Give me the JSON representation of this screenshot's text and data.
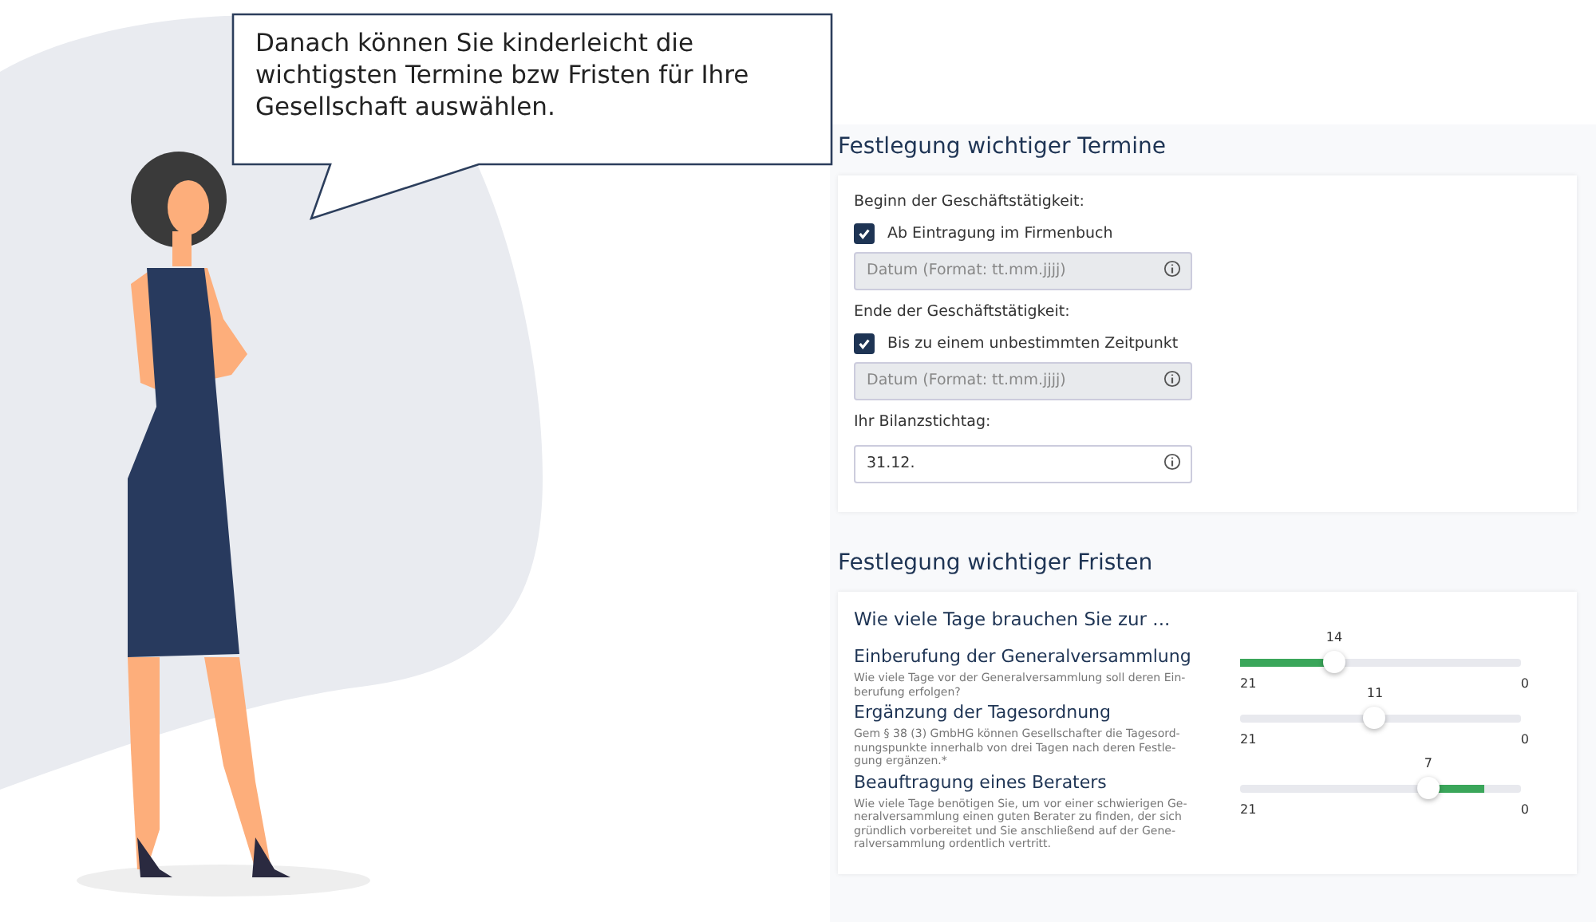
{
  "bubble": {
    "text": "Danach können Sie kinderleicht die wichtigsten Termine bzw Fristen für Ihre Gesellschaft auswählen."
  },
  "termine": {
    "title": "Festlegung wichtiger Termine",
    "groups": [
      {
        "label": "Beginn der Geschäftstätigkeit:",
        "checkbox": {
          "label": "Ab Eintragung im Firmenbuch",
          "checked": true
        },
        "field": {
          "placeholder": "Datum (Format: tt.mm.jjjj)",
          "disabled": true
        }
      },
      {
        "label": "Ende der Geschäftstätigkeit:",
        "checkbox": {
          "label": "Bis zu einem unbestimmten Zeitpunkt",
          "checked": true
        },
        "field": {
          "placeholder": "Datum (Format: tt.mm.jjjj)",
          "disabled": true
        }
      },
      {
        "label": "Ihr Bilanzstichtag:",
        "field": {
          "value": "31.12.",
          "disabled": false
        }
      }
    ]
  },
  "fristen": {
    "title": "Festlegung wichtiger Fristen",
    "question": "Wie viele Tage brauchen Sie zur ...",
    "items": [
      {
        "title": "Einberufung der Generalversammlung",
        "description": [
          "Wie viele Tage vor der Generalversammlung soll deren Ein-",
          "berufung erfolgen?"
        ],
        "value": "14",
        "level": 0.335,
        "kind": "fill-left",
        "min": "21",
        "max": "0"
      },
      {
        "title": "Ergänzung der Tagesordnung",
        "description": [
          "Gem § 38 (3) GmbHG können Gesellschafter die Tagesord-",
          "nungspunkte innerhalb von drei Tagen nach deren Festle-",
          "gung ergänzen.*"
        ],
        "value": "11",
        "level": 0.48,
        "kind": "plain",
        "min": "21",
        "max": "0"
      },
      {
        "title": "Beauftragung eines Beraters",
        "description": [
          "Wie viele Tage benötigen Sie, um vor einer schwierigen Ge-",
          "neralversammlung einen guten Berater zu finden, der sich",
          "gründlich vorbereitet und Sie anschließend auf der Gene-",
          "ralversammlung ordentlich vertritt."
        ],
        "value": "7",
        "level": 0.67,
        "kind": "fill-right",
        "min": "21",
        "max": "0"
      }
    ]
  }
}
